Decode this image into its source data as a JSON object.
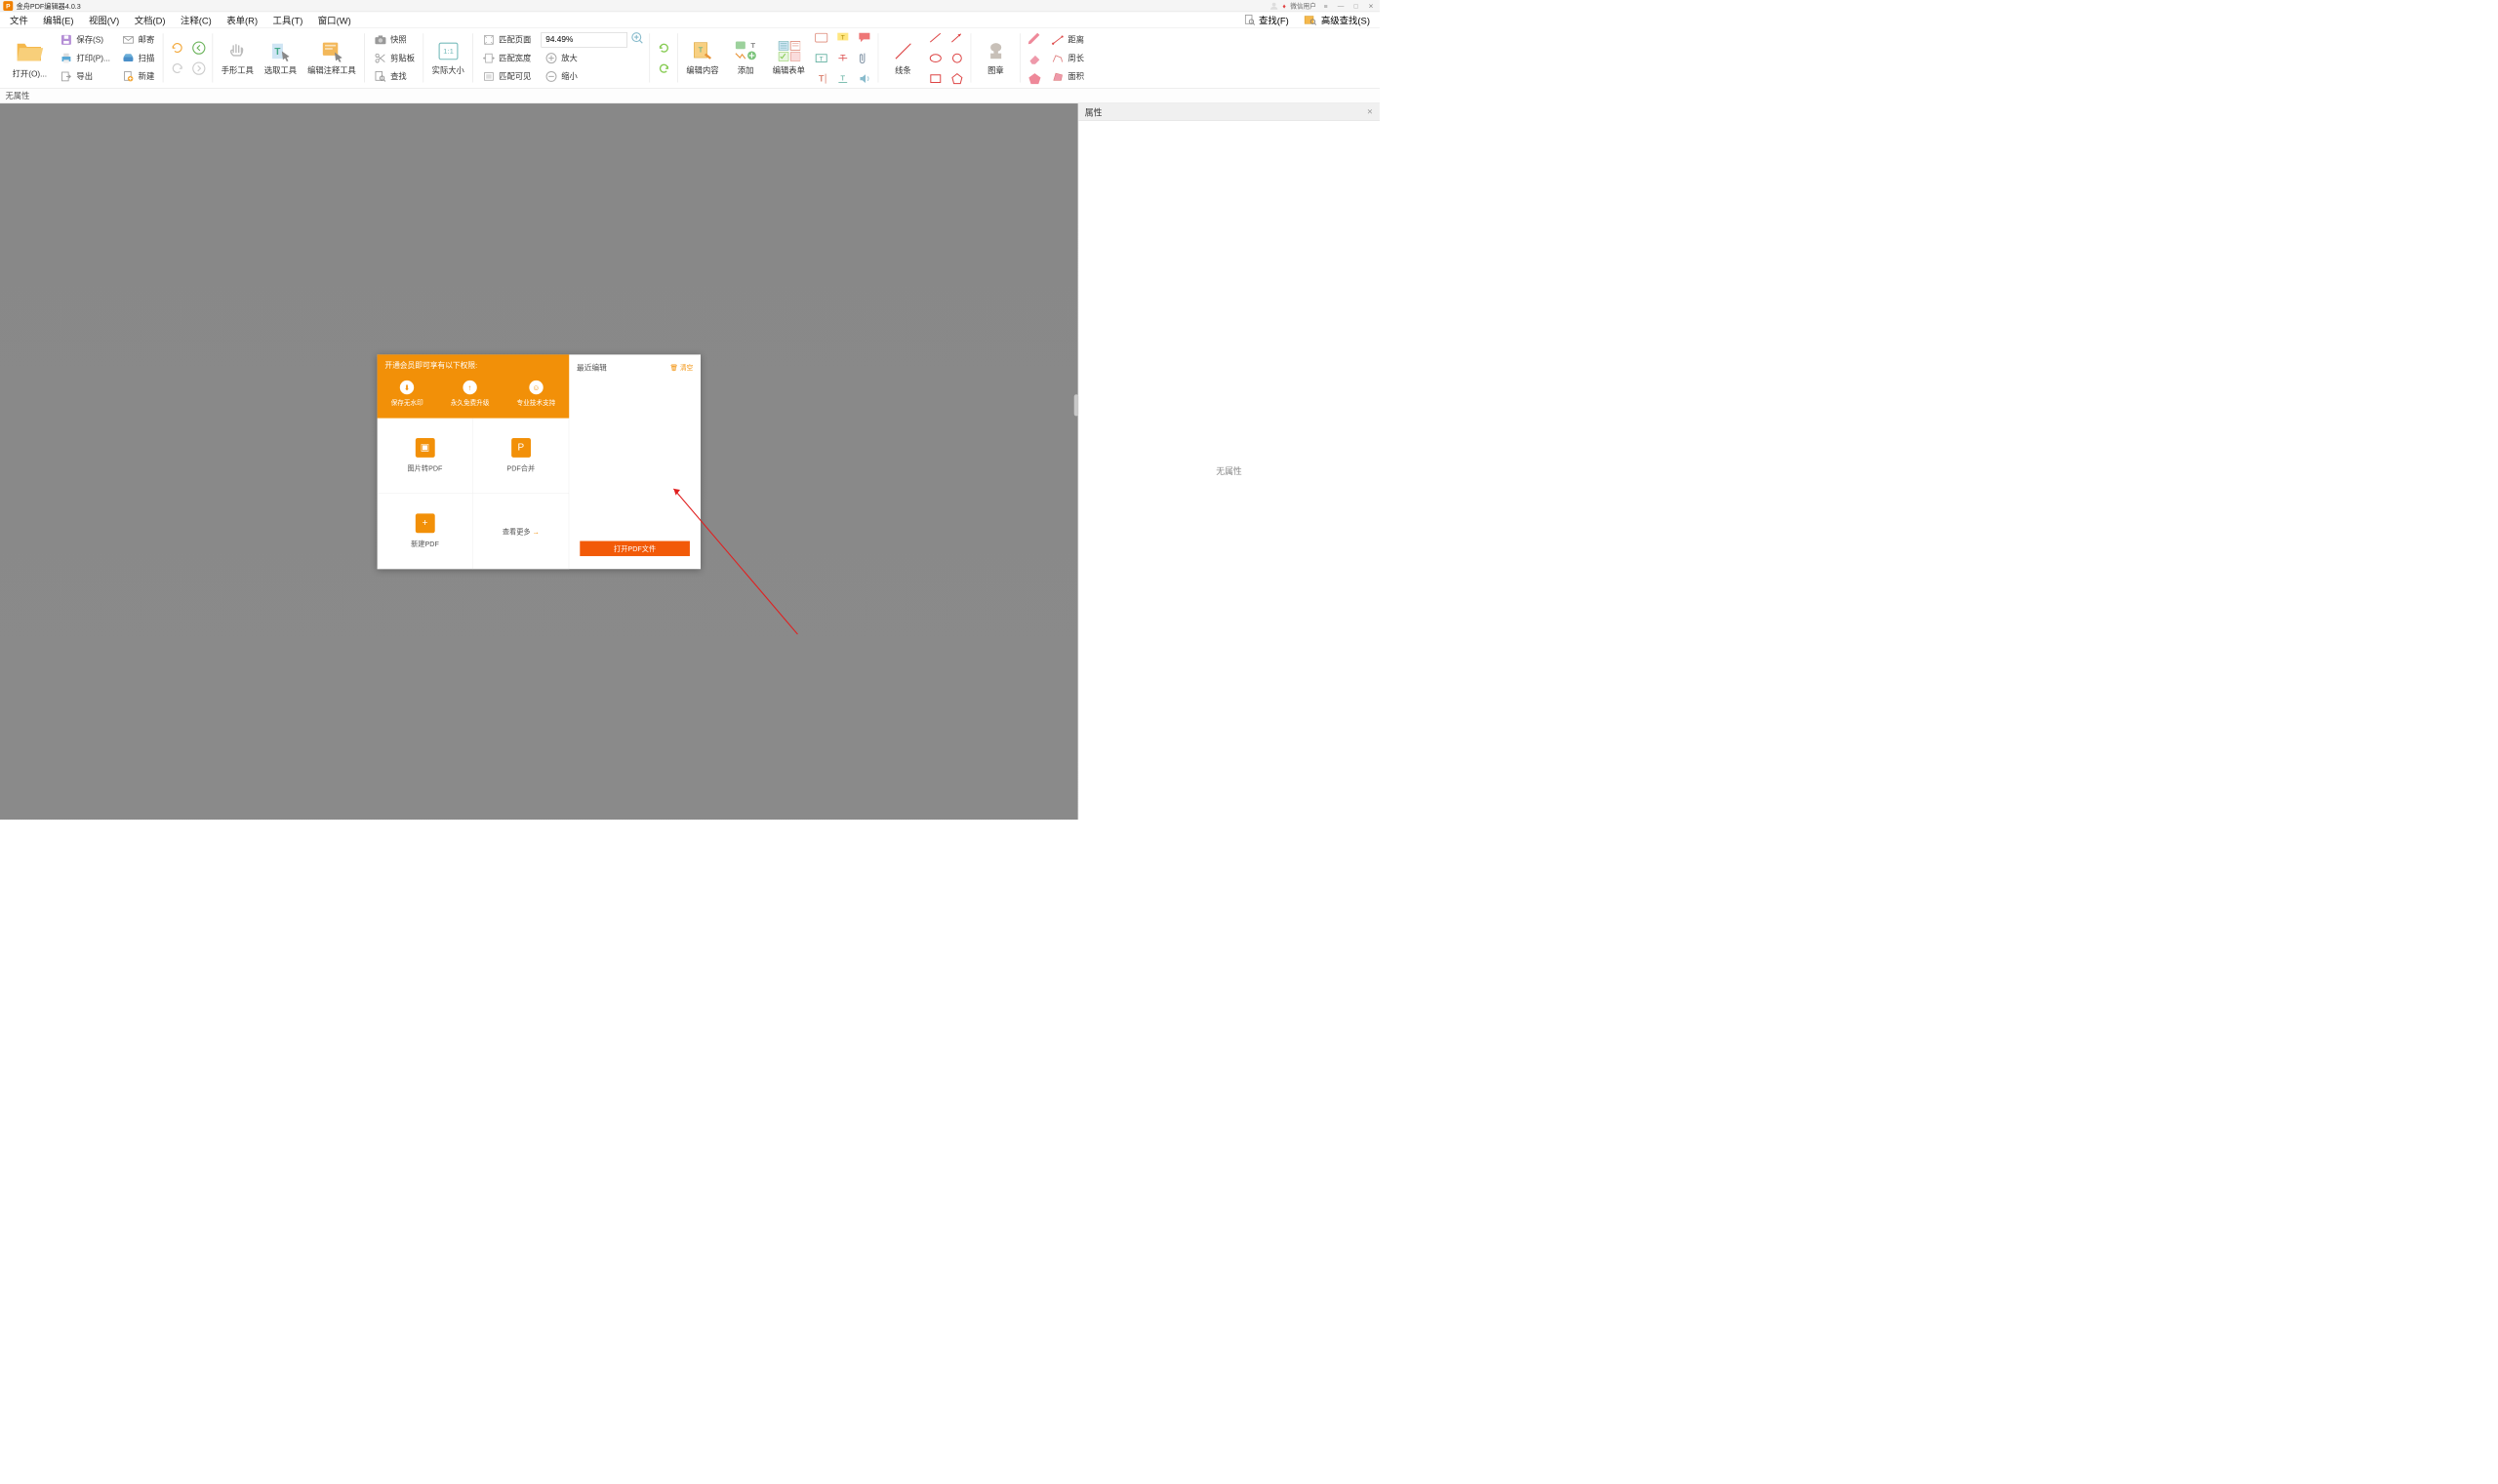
{
  "app": {
    "title": "金舟PDF编辑器4.0.3",
    "icon_letter": "P"
  },
  "user": {
    "name": "微信用户"
  },
  "window": {
    "menu": "≡",
    "min": "—",
    "max": "□",
    "close": "✕"
  },
  "menu": {
    "file": "文件",
    "edit": "编辑(E)",
    "view": "视图(V)",
    "document": "文档(D)",
    "annotate": "注释(C)",
    "form": "表单(R)",
    "tools": "工具(T)",
    "window": "窗口(W)"
  },
  "find": {
    "find": "查找(F)",
    "advanced": "高级查找(S)"
  },
  "toolbar": {
    "open": "打开(O)...",
    "save": "保存(S)",
    "print": "打印(P)...",
    "export": "导出",
    "mail": "邮寄",
    "scan": "扫描",
    "new": "新建",
    "hand": "手形工具",
    "select": "选取工具",
    "edit_annotate": "编辑注释工具",
    "snapshot": "快照",
    "clipboard": "剪贴板",
    "find_tool": "查找",
    "actual_size": "实际大小",
    "fit_page": "匹配页面",
    "fit_width": "匹配宽度",
    "fit_visible": "匹配可见",
    "zoom_in": "放大",
    "zoom_out": "缩小",
    "zoom_value": "94.49%",
    "edit_content": "编辑内容",
    "add": "添加",
    "edit_form": "编辑表单",
    "lines": "线条",
    "stamp": "图章",
    "distance": "距离",
    "perimeter": "周长",
    "area": "面积"
  },
  "status": {
    "no_props": "无属性"
  },
  "props": {
    "title": "属性",
    "empty": "无属性"
  },
  "start": {
    "banner_title": "开通会员即可享有以下权限:",
    "perk1": "保存无水印",
    "perk2": "永久免费升级",
    "perk3": "专业技术支持",
    "img_to_pdf": "图片转PDF",
    "pdf_merge": "PDF合并",
    "new_pdf": "新建PDF",
    "see_more": "查看更多",
    "recent": "最近编辑",
    "clear": "清空",
    "open_pdf": "打开PDF文件"
  }
}
